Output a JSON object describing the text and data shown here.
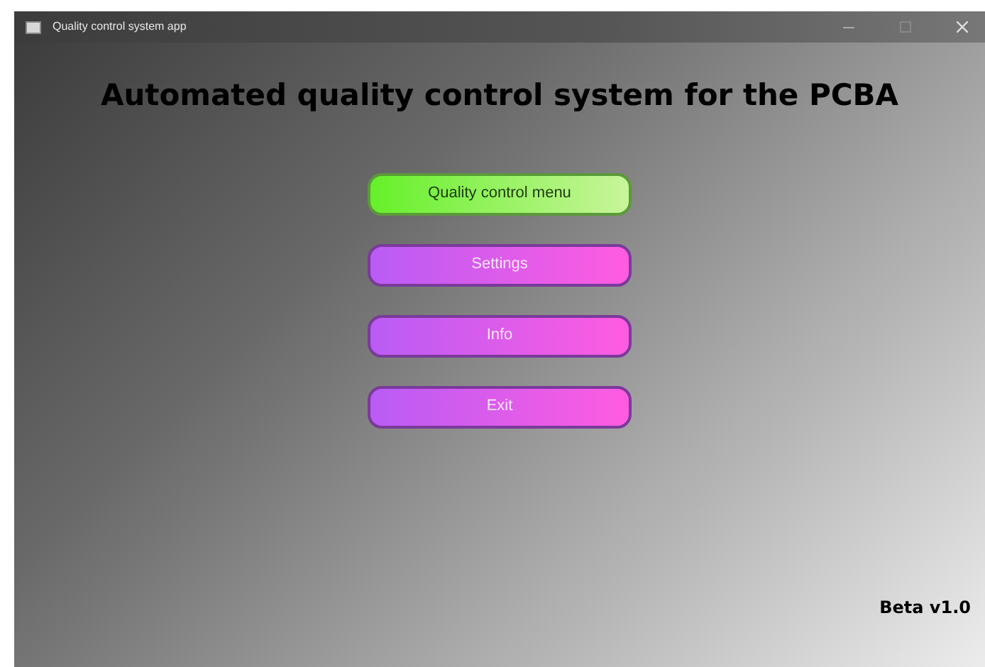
{
  "window": {
    "title": "Quality control system app"
  },
  "heading": "Automated quality control system for the PCBA",
  "menu_buttons": [
    {
      "label": "Quality control menu",
      "selected": true
    },
    {
      "label": "Settings",
      "selected": false
    },
    {
      "label": "Info",
      "selected": false
    },
    {
      "label": "Exit",
      "selected": false
    }
  ],
  "version": "Beta v1.0"
}
